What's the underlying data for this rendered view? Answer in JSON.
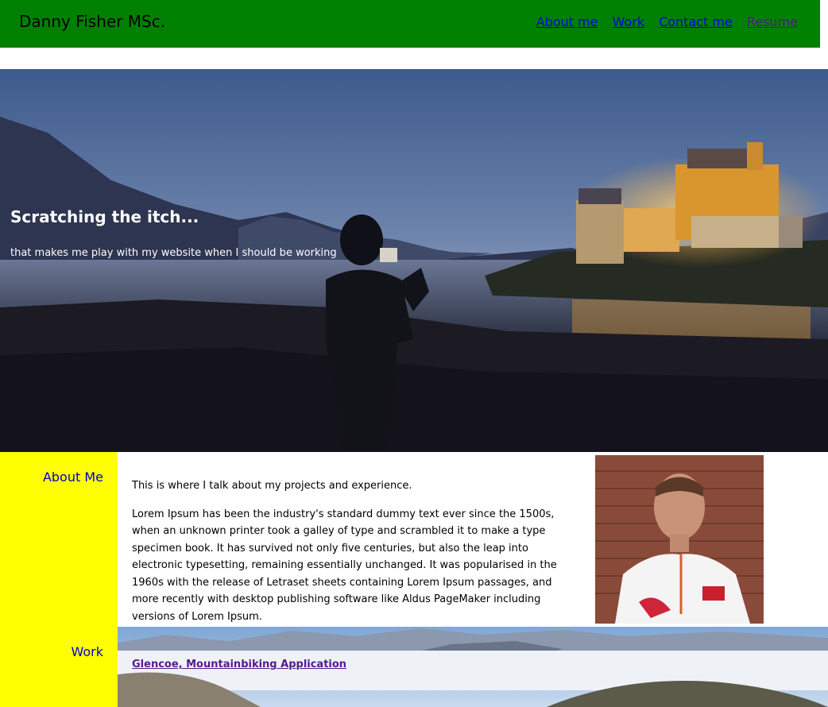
{
  "header": {
    "site_title": "Danny Fisher MSc.",
    "nav": [
      {
        "label": "About me"
      },
      {
        "label": "Work"
      },
      {
        "label": "Contact me"
      },
      {
        "label": "Resume"
      }
    ],
    "background_color": "#008000"
  },
  "hero": {
    "heading": "Scratching the itch...",
    "subheading": "that makes me play with my website when I should be working"
  },
  "about": {
    "side_label": "About Me",
    "paragraphs": [
      "This is where I talk about my projects and experience.",
      "Lorem Ipsum has been the industry's standard dummy text ever since the 1500s, when an unknown printer took a galley of type and scrambled it to make a type specimen book. It has survived not only five centuries, but also the leap into electronic typesetting, remaining essentially unchanged. It was popularised in the 1960s with the release of Letraset sheets containing Lorem Ipsum passages, and more recently with desktop publishing software like Aldus PageMaker including versions of Lorem Ipsum."
    ]
  },
  "work": {
    "side_label": "Work",
    "project_link": "Glencoe, Mountainbiking Application"
  },
  "colors": {
    "sidebar": "#ffff00",
    "link": "#0000ee",
    "visited_link": "#551a8b"
  }
}
